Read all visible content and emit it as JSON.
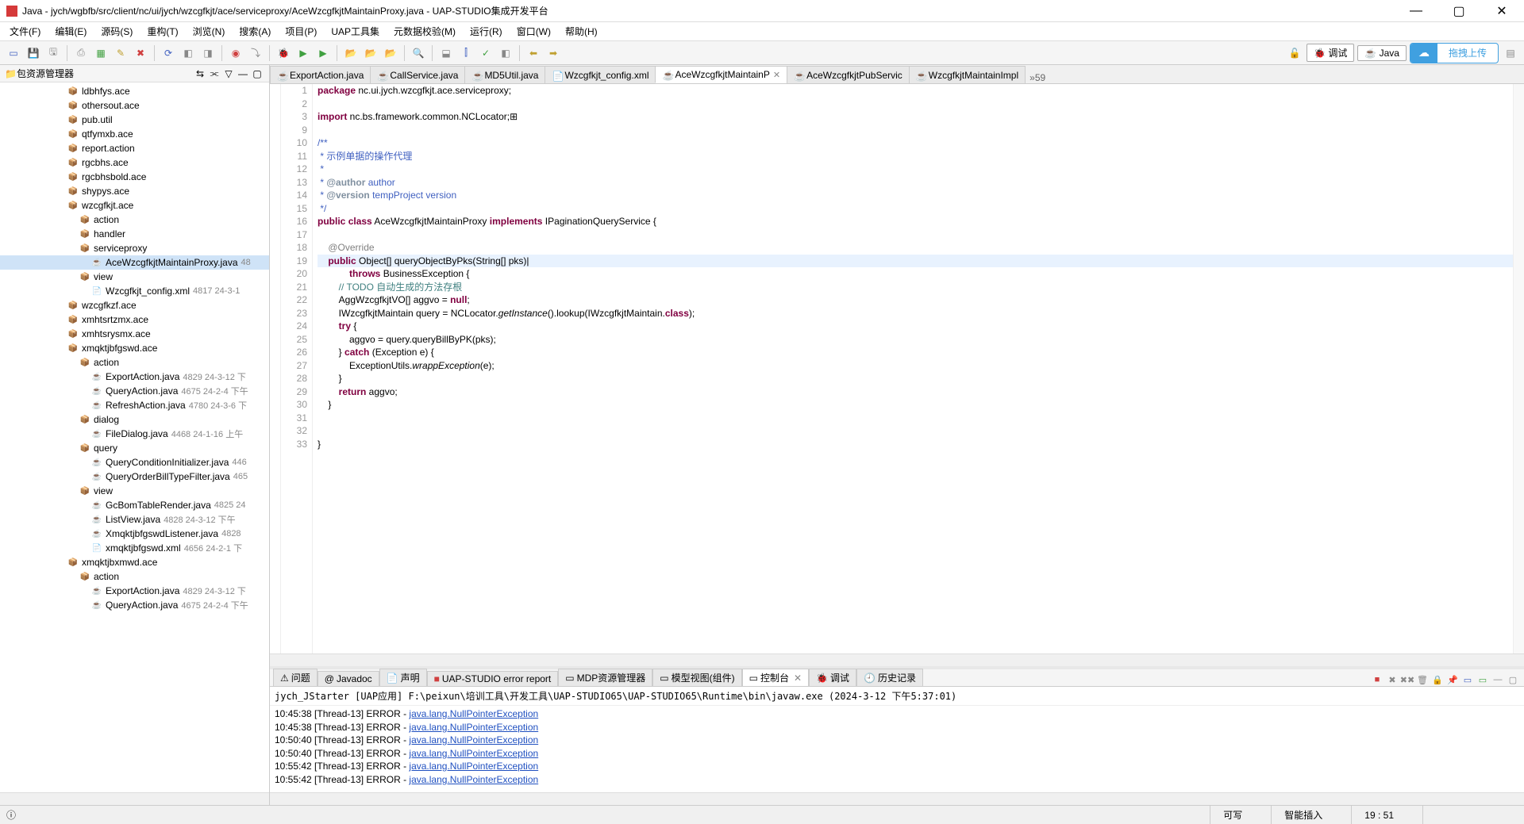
{
  "window": {
    "title": "Java - jych/wgbfb/src/client/nc/ui/jych/wzcgfkjt/ace/serviceproxy/AceWzcgfkjtMaintainProxy.java - UAP-STUDIO集成开发平台"
  },
  "menu": [
    "文件(F)",
    "编辑(E)",
    "源码(S)",
    "重构(T)",
    "浏览(N)",
    "搜索(A)",
    "项目(P)",
    "UAP工具集",
    "元数据校验(M)",
    "运行(R)",
    "窗口(W)",
    "帮助(H)"
  ],
  "perspective": {
    "debug": "调试",
    "java": "Java"
  },
  "upload": {
    "label": "拖拽上传"
  },
  "sidebar": {
    "title": "包资源管理器",
    "items": [
      {
        "ind": 1,
        "icon": "pkg",
        "name": "ldbhfys.ace"
      },
      {
        "ind": 1,
        "icon": "pkg",
        "name": "othersout.ace"
      },
      {
        "ind": 1,
        "icon": "pkg",
        "name": "pub.util"
      },
      {
        "ind": 1,
        "icon": "pkg",
        "name": "qtfymxb.ace"
      },
      {
        "ind": 1,
        "icon": "pkg",
        "name": "report.action"
      },
      {
        "ind": 1,
        "icon": "pkg",
        "name": "rgcbhs.ace"
      },
      {
        "ind": 1,
        "icon": "pkg",
        "name": "rgcbhsbold.ace"
      },
      {
        "ind": 1,
        "icon": "pkg",
        "name": "shypys.ace"
      },
      {
        "ind": 1,
        "icon": "pkg",
        "name": "wzcgfkjt.ace",
        "open": true
      },
      {
        "ind": 2,
        "icon": "pkg",
        "name": "action"
      },
      {
        "ind": 2,
        "icon": "pkg",
        "name": "handler"
      },
      {
        "ind": 2,
        "icon": "pkg",
        "name": "serviceproxy",
        "open": true
      },
      {
        "ind": 3,
        "icon": "java",
        "name": "AceWzcgfkjtMaintainProxy.java",
        "meta": "48",
        "selected": true
      },
      {
        "ind": 2,
        "icon": "pkg",
        "name": "view",
        "open": true
      },
      {
        "ind": 3,
        "icon": "xml",
        "name": "Wzcgfkjt_config.xml",
        "meta": "4817  24-3-1"
      },
      {
        "ind": 1,
        "icon": "pkg",
        "name": "wzcgfkzf.ace"
      },
      {
        "ind": 1,
        "icon": "pkg",
        "name": "xmhtsrtzmx.ace"
      },
      {
        "ind": 1,
        "icon": "pkg",
        "name": "xmhtsrysmx.ace"
      },
      {
        "ind": 1,
        "icon": "pkg",
        "name": "xmqktjbfgswd.ace",
        "open": true
      },
      {
        "ind": 2,
        "icon": "pkg",
        "name": "action",
        "open": true
      },
      {
        "ind": 3,
        "icon": "java",
        "name": "ExportAction.java",
        "meta": "4829  24-3-12 下"
      },
      {
        "ind": 3,
        "icon": "java",
        "name": "QueryAction.java",
        "meta": "4675  24-2-4 下午"
      },
      {
        "ind": 3,
        "icon": "java",
        "name": "RefreshAction.java",
        "meta": "4780  24-3-6 下"
      },
      {
        "ind": 2,
        "icon": "pkg",
        "name": "dialog",
        "open": true
      },
      {
        "ind": 3,
        "icon": "java",
        "name": "FileDialog.java",
        "meta": "4468  24-1-16 上午"
      },
      {
        "ind": 2,
        "icon": "pkg",
        "name": "query",
        "open": true
      },
      {
        "ind": 3,
        "icon": "java",
        "name": "QueryConditionInitializer.java",
        "meta": "446"
      },
      {
        "ind": 3,
        "icon": "java",
        "name": "QueryOrderBillTypeFilter.java",
        "meta": "465"
      },
      {
        "ind": 2,
        "icon": "pkg",
        "name": "view",
        "open": true
      },
      {
        "ind": 3,
        "icon": "java",
        "name": "GcBomTableRender.java",
        "meta": "4825  24"
      },
      {
        "ind": 3,
        "icon": "java",
        "name": "ListView.java",
        "meta": "4828  24-3-12 下午"
      },
      {
        "ind": 3,
        "icon": "java",
        "name": "XmqktjbfgswdListener.java",
        "meta": "4828"
      },
      {
        "ind": 3,
        "icon": "xml",
        "name": "xmqktjbfgswd.xml",
        "meta": "4656  24-2-1 下"
      },
      {
        "ind": 1,
        "icon": "pkg",
        "name": "xmqktjbxmwd.ace",
        "open": true
      },
      {
        "ind": 2,
        "icon": "pkg",
        "name": "action",
        "open": true
      },
      {
        "ind": 3,
        "icon": "java",
        "name": "ExportAction.java",
        "meta": "4829  24-3-12 下"
      },
      {
        "ind": 3,
        "icon": "java",
        "name": "QueryAction.java",
        "meta": "4675  24-2-4 下午"
      }
    ]
  },
  "editor_tabs": [
    {
      "name": "ExportAction.java",
      "icon": "java"
    },
    {
      "name": "CallService.java",
      "icon": "java"
    },
    {
      "name": "MD5Util.java",
      "icon": "java"
    },
    {
      "name": "Wzcgfkjt_config.xml",
      "icon": "xml"
    },
    {
      "name": "AceWzcgfkjtMaintainP",
      "icon": "java",
      "active": true
    },
    {
      "name": "AceWzcgfkjtPubServic",
      "icon": "java"
    },
    {
      "name": "WzcgfkjtMaintainImpl",
      "icon": "java"
    }
  ],
  "editor_more": "»59",
  "code": {
    "start_line": 1,
    "extra_lines": [
      "2",
      "3",
      "9",
      "10",
      "11",
      "12",
      "13",
      "14",
      "15",
      "16",
      "17",
      "18",
      "19",
      "20",
      "21",
      "22",
      "23",
      "24",
      "25",
      "26",
      "27",
      "28",
      "29",
      "30",
      "31",
      "32",
      "33"
    ],
    "line1": {
      "kw1": "package",
      "rest": " nc.ui.jych.wzcgfkjt.ace.serviceproxy;"
    },
    "line3": {
      "kw1": "import",
      "rest": " nc.bs.framework.common.NCLocator;"
    },
    "line10": "/**",
    "line11": " * 示例单据的操作代理",
    "line12": " * ",
    "line13_a": " * ",
    "line13_b": "@author",
    "line13_c": " author",
    "line14_a": " * ",
    "line14_b": "@version",
    "line14_c": " tempProject version",
    "line15": " */",
    "line16": {
      "kw1": "public",
      "kw2": "class",
      "cls": "AceWzcgfkjtMaintainProxy",
      "kw3": "implements",
      "iface": "IPaginationQueryService {"
    },
    "line18": "@Override",
    "line19": {
      "kw1": "public",
      "rest1": " Object[] queryObjectByPks(String[] pks)|"
    },
    "line20": {
      "kw1": "throws",
      "rest": " BusinessException {"
    },
    "line21": "// TODO 自动生成的方法存根",
    "line22": {
      "rest1": "AggWzcgfkjtVO[] aggvo = ",
      "kw1": "null",
      "rest2": ";"
    },
    "line23": {
      "rest1": "IWzcgfkjtMaintain query = NCLocator.",
      "it": "getInstance",
      "rest2": "().lookup(IWzcgfkjtMaintain.",
      "kw1": "class",
      "rest3": ");"
    },
    "line24": {
      "kw1": "try",
      "rest": " {"
    },
    "line25": "aggvo = query.queryBillByPK(pks);",
    "line26": {
      "rest1": "} ",
      "kw1": "catch",
      "rest2": " (Exception e) {"
    },
    "line27": {
      "rest1": "ExceptionUtils.",
      "it": "wrappException",
      "rest2": "(e);"
    },
    "line28": "}",
    "line29": {
      "kw1": "return",
      "rest": " aggvo;"
    },
    "line30": "}",
    "line33": "}"
  },
  "bottom_tabs": [
    {
      "name": "问题",
      "icon": "⚠"
    },
    {
      "name": "Javadoc",
      "icon": "@"
    },
    {
      "name": "声明",
      "icon": "📄"
    },
    {
      "name": "UAP-STUDIO error report",
      "icon": "■",
      "red": true
    },
    {
      "name": "MDP资源管理器",
      "icon": "▭"
    },
    {
      "name": "模型视图(组件)",
      "icon": "▭"
    },
    {
      "name": "控制台",
      "icon": "▭",
      "active": true,
      "closable": true
    },
    {
      "name": "调试",
      "icon": "🐞"
    },
    {
      "name": "历史记录",
      "icon": "🕘"
    }
  ],
  "console": {
    "header": "jych_JStarter [UAP应用] F:\\peixun\\培训工具\\开发工具\\UAP-STUDIO65\\UAP-STUDIO65\\Runtime\\bin\\javaw.exe (2024-3-12 下午5:37:01)",
    "lines": [
      {
        "time": "10:45:38",
        "thread": "[Thread-13]",
        "level": "ERROR",
        "sep": " - ",
        "exc": "java.lang.NullPointerException"
      },
      {
        "time": "10:45:38",
        "thread": "[Thread-13]",
        "level": "ERROR",
        "sep": " - ",
        "exc": "java.lang.NullPointerException"
      },
      {
        "time": "10:50:40",
        "thread": "[Thread-13]",
        "level": "ERROR",
        "sep": " - ",
        "exc": "java.lang.NullPointerException"
      },
      {
        "time": "10:50:40",
        "thread": "[Thread-13]",
        "level": "ERROR",
        "sep": " - ",
        "exc": "java.lang.NullPointerException"
      },
      {
        "time": "10:55:42",
        "thread": "[Thread-13]",
        "level": "ERROR",
        "sep": " - ",
        "exc": "java.lang.NullPointerException"
      },
      {
        "time": "10:55:42",
        "thread": "[Thread-13]",
        "level": "ERROR",
        "sep": " - ",
        "exc": "java.lang.NullPointerException"
      }
    ]
  },
  "status": {
    "writable": "可写",
    "insert": "智能插入",
    "pos": "19 :  51"
  }
}
